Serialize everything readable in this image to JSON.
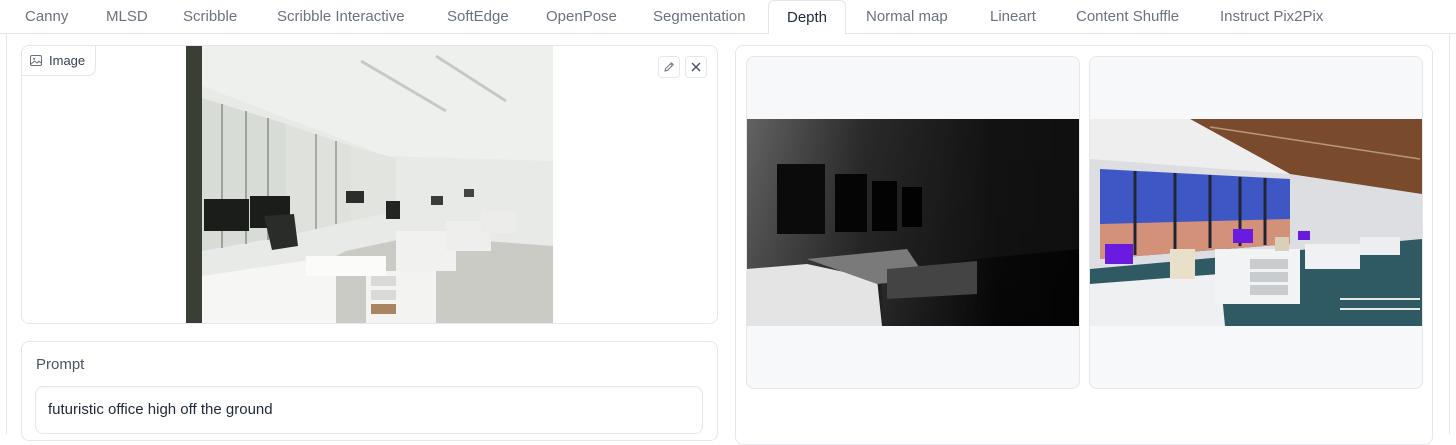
{
  "tabs": [
    {
      "label": "Canny"
    },
    {
      "label": "MLSD"
    },
    {
      "label": "Scribble"
    },
    {
      "label": "Scribble Interactive"
    },
    {
      "label": "SoftEdge"
    },
    {
      "label": "OpenPose"
    },
    {
      "label": "Segmentation"
    },
    {
      "label": "Depth",
      "selected": true
    },
    {
      "label": "Normal map"
    },
    {
      "label": "Lineart"
    },
    {
      "label": "Content Shuffle"
    },
    {
      "label": "Instruct Pix2Pix"
    }
  ],
  "image_input": {
    "label": "Image",
    "icons": [
      "image-icon",
      "pencil-icon",
      "close-icon"
    ]
  },
  "prompt": {
    "label": "Prompt",
    "value": "futuristic office high off the ground"
  },
  "colors": {
    "accent_border": "#e5e7eb",
    "tab_text": "#6b7280",
    "tab_selected_text": "#1f2937",
    "thumb_bg": "#f7f8fa"
  }
}
